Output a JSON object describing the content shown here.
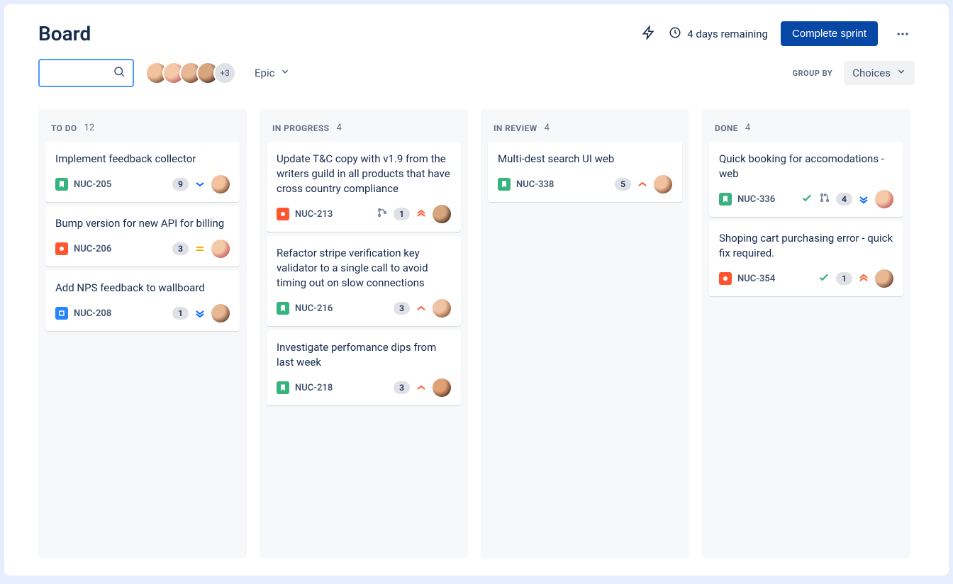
{
  "header": {
    "title": "Board",
    "days_remaining": "4 days remaining",
    "complete_sprint": "Complete sprint",
    "avatars_extra": "+3",
    "epic_label": "Epic",
    "group_by_label": "GROUP BY",
    "choices_label": "Choices"
  },
  "columns": [
    {
      "title": "TO DO",
      "count": "12",
      "cards": [
        {
          "title": "Implement feedback collector",
          "key": "NUC-205",
          "type": "story",
          "points": "9",
          "priority": "low"
        },
        {
          "title": "Bump version for new API for billing",
          "key": "NUC-206",
          "type": "bug",
          "points": "3",
          "priority": "medium"
        },
        {
          "title": "Add NPS feedback to wallboard",
          "key": "NUC-208",
          "type": "task",
          "points": "1",
          "priority": "lowest"
        }
      ]
    },
    {
      "title": "IN PROGRESS",
      "count": "4",
      "cards": [
        {
          "title": "Update T&C copy with v1.9 from the writers guild in all products that have cross country compliance",
          "key": "NUC-213",
          "type": "bug",
          "points": "1",
          "priority": "highest",
          "has_branch": true
        },
        {
          "title": "Refactor stripe verification key validator to a single call to avoid timing out on slow connections",
          "key": "NUC-216",
          "type": "story",
          "points": "3",
          "priority": "high"
        },
        {
          "title": "Investigate perfomance dips from last week",
          "key": "NUC-218",
          "type": "story",
          "points": "3",
          "priority": "high"
        }
      ]
    },
    {
      "title": "IN REVIEW",
      "count": "4",
      "cards": [
        {
          "title": "Multi-dest search UI web",
          "key": "NUC-338",
          "type": "story",
          "points": "5",
          "priority": "high"
        }
      ]
    },
    {
      "title": "DONE",
      "count": "4",
      "cards": [
        {
          "title": "Quick booking for accomodations - web",
          "key": "NUC-336",
          "type": "story",
          "pr_count": "4",
          "priority": "lowest",
          "has_check": true,
          "has_pr": true
        },
        {
          "title": "Shoping cart purchasing error - quick fix required.",
          "key": "NUC-354",
          "type": "bug",
          "points": "1",
          "priority": "highest",
          "has_check": true
        }
      ]
    }
  ]
}
